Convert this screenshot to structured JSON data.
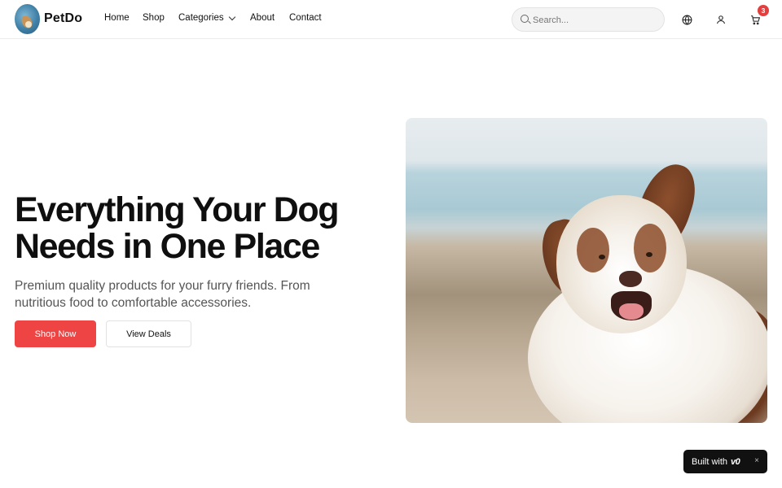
{
  "brand": {
    "name": "PetDo",
    "logo_icon": "dog-logo-icon"
  },
  "nav": {
    "home": "Home",
    "shop": "Shop",
    "categories": "Categories",
    "about": "About",
    "contact": "Contact"
  },
  "search": {
    "placeholder": "Search...",
    "value": ""
  },
  "header_icons": {
    "globe": "globe-icon",
    "user": "user-icon",
    "cart": "cart-icon",
    "cart_count": "3"
  },
  "hero": {
    "title_line1": "Everything Your Dog",
    "title_line2": "Needs in One Place",
    "subtitle": "Premium quality products for your furry friends. From nutritious food to comfortable accessories.",
    "primary_button": "Shop Now",
    "secondary_button": "View Deals"
  },
  "badge": {
    "built_with": "Built with",
    "brand_mark": "v0",
    "close": "×"
  },
  "colors": {
    "accent": "#ef4444",
    "cart_badge": "#e53e3e",
    "text_dark": "#0f0f0f",
    "text_muted": "#555555"
  }
}
